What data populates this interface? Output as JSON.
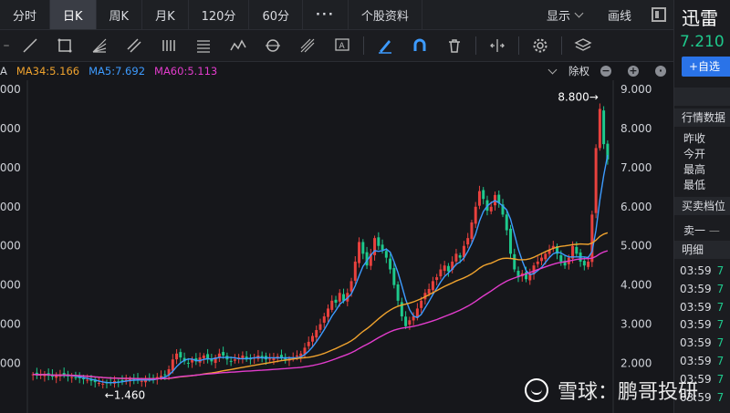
{
  "tabs": [
    {
      "label": "分时",
      "active": false
    },
    {
      "label": "日K",
      "active": true
    },
    {
      "label": "周K",
      "active": false
    },
    {
      "label": "月K",
      "active": false
    },
    {
      "label": "120分",
      "active": false
    },
    {
      "label": "60分",
      "active": false
    },
    {
      "label": "···",
      "active": false
    },
    {
      "label": "个股资料",
      "active": false
    }
  ],
  "header_right": {
    "display_label": "显示",
    "draw_label": "画线"
  },
  "legend": {
    "ma34": "MA34:5.166",
    "ma5": "MA5:7.692",
    "ma60": "MA60:5.113",
    "adjust": "除权",
    "prefix": "A"
  },
  "colors": {
    "ma5": "#3d9bff",
    "ma34": "#f0a32e",
    "ma60": "#e23ccc",
    "up": "#e8413e",
    "down": "#1ec98c",
    "bg": "#16171b"
  },
  "side": {
    "name": "迅雷",
    "price": "7.210",
    "add_label": "+自选",
    "quote_header": "行情数据",
    "quote_rows": [
      "昨收",
      "今开",
      "最高",
      "最低"
    ],
    "bidask_header": "买卖档位",
    "bid_label": "卖一",
    "detail_header": "明细",
    "ticks": [
      {
        "time": "03:59",
        "val": "7"
      },
      {
        "time": "03:59",
        "val": "7"
      },
      {
        "time": "03:59",
        "val": "7"
      },
      {
        "time": "03:59",
        "val": "7"
      },
      {
        "time": "03:59",
        "val": "7"
      },
      {
        "time": "03:59",
        "val": "7"
      },
      {
        "time": "03:59",
        "val": "7"
      },
      {
        "time": "03:59",
        "val": "7"
      }
    ]
  },
  "watermark": "雪球：鹏哥投研",
  "chart_data": {
    "type": "candlestick",
    "ylim": [
      1.5,
      9.0
    ],
    "yticks_right": [
      "9.000",
      "8.000",
      "7.000",
      "6.000",
      "5.000",
      "4.000",
      "3.000",
      "2.000"
    ],
    "yticks_left": [
      ".000",
      ".000",
      ".000",
      ".000",
      ".000",
      ".000",
      ".000",
      ".000"
    ],
    "annotations": [
      {
        "text": "8.800→",
        "x": 220,
        "y": 8.8
      },
      {
        "text": "←1.460",
        "x": 22,
        "y": 1.46
      }
    ],
    "close": [
      1.72,
      1.7,
      1.71,
      1.73,
      1.68,
      1.66,
      1.69,
      1.72,
      1.7,
      1.67,
      1.65,
      1.63,
      1.62,
      1.6,
      1.58,
      1.55,
      1.52,
      1.5,
      1.48,
      1.5,
      1.52,
      1.55,
      1.53,
      1.55,
      1.58,
      1.6,
      1.58,
      1.56,
      1.55,
      1.58,
      1.6,
      1.62,
      1.65,
      1.68,
      1.7,
      1.85,
      2.1,
      2.25,
      2.15,
      2.05,
      2.0,
      2.1,
      2.05,
      2.15,
      2.2,
      2.1,
      2.05,
      2.15,
      2.25,
      2.2,
      2.1,
      2.05,
      2.1,
      2.15,
      2.2,
      2.1,
      2.1,
      2.15,
      2.2,
      2.15,
      2.1,
      2.12,
      2.15,
      2.18,
      2.15,
      2.1,
      2.12,
      2.15,
      2.2,
      2.25,
      2.4,
      2.55,
      2.7,
      2.85,
      3.0,
      3.2,
      3.4,
      3.6,
      3.55,
      3.8,
      3.6,
      3.8,
      4.1,
      4.6,
      5.1,
      4.8,
      4.5,
      4.8,
      5.2,
      5.0,
      4.9,
      4.7,
      4.4,
      4.0,
      3.6,
      3.2,
      2.95,
      3.1,
      3.2,
      3.4,
      3.6,
      3.8,
      3.9,
      4.1,
      4.2,
      4.4,
      4.5,
      4.35,
      4.6,
      4.8,
      4.7,
      5.0,
      5.2,
      5.6,
      6.0,
      6.4,
      6.2,
      5.9,
      6.0,
      6.3,
      6.1,
      5.8,
      5.4,
      4.8,
      4.4,
      4.2,
      4.3,
      4.15,
      4.3,
      4.5,
      4.6,
      4.7,
      4.8,
      4.9,
      5.0,
      4.8,
      4.6,
      4.5,
      4.7,
      5.0,
      4.8,
      4.6,
      4.5,
      4.6,
      5.8,
      7.5,
      8.5,
      7.6,
      7.21
    ],
    "series": [
      {
        "name": "MA5",
        "values": []
      },
      {
        "name": "MA34",
        "values": []
      },
      {
        "name": "MA60",
        "values": []
      }
    ],
    "grid": false
  }
}
